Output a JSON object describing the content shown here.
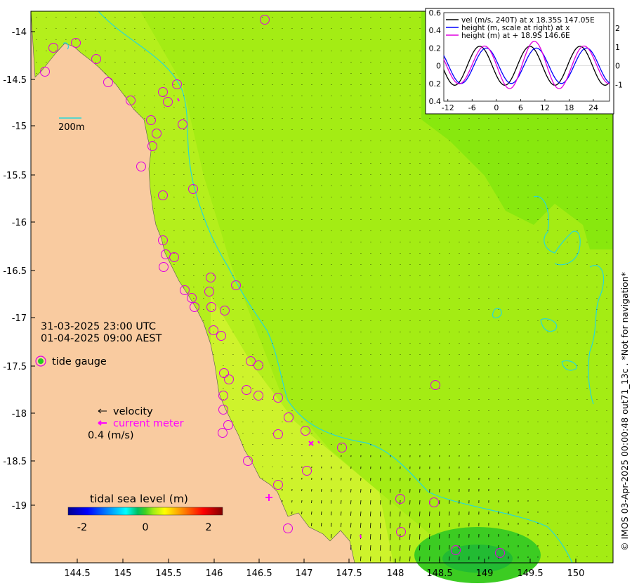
{
  "map": {
    "y_ticks": [
      "-14",
      "-14.5",
      "-15",
      "-15.5",
      "-16",
      "-16.5",
      "-17",
      "-17.5",
      "-18",
      "-18.5",
      "-19"
    ],
    "x_ticks": [
      "144.5",
      "145",
      "145.5",
      "146",
      "146.5",
      "147",
      "147.5",
      "148",
      "148.5",
      "149",
      "149.5",
      "150"
    ],
    "scale_label": "200m",
    "datetime_utc": "31-03-2025 23:00 UTC",
    "datetime_local": "01-04-2025 09:00 AEST",
    "tide_gauge_label": "tide gauge",
    "velocity_label": "velocity",
    "current_meter_label": "current meter",
    "velocity_scale_label": "0.4 (m/s)",
    "colorbar_title": "tidal sea level (m)",
    "colorbar_ticks": [
      "-2",
      "0",
      "2"
    ],
    "side_credit": "© IMOS 03-Apr-2025 00:00:48 out71_13c . *Not for navigation*",
    "colors": {
      "land": "#f9cba0",
      "sea_main": "#a4ec14",
      "sea_deep": "#88e80e",
      "sea_inner": "#cef32c",
      "contour": "#28d8d8",
      "gauge": "#e000e0",
      "current_meter": "#ff00ff"
    }
  },
  "inset": {
    "y_left_ticks": [
      "0.6",
      "0.4",
      "0.2",
      "0",
      "0.2",
      "0.4"
    ],
    "y_right_ticks": [
      "2",
      "1",
      "0",
      "-1"
    ],
    "x_ticks": [
      "-12",
      "-6",
      "0",
      "6",
      "12",
      "18",
      "24"
    ],
    "legend": [
      {
        "label": "vel (m/s, 240T) at x 18.35S 147.05E",
        "color": "#000000"
      },
      {
        "label": "height (m, scale at right) at x",
        "color": "#0000ff"
      },
      {
        "label": "height (m) at + 18.9S 146.6E",
        "color": "#e000e0"
      }
    ]
  }
}
